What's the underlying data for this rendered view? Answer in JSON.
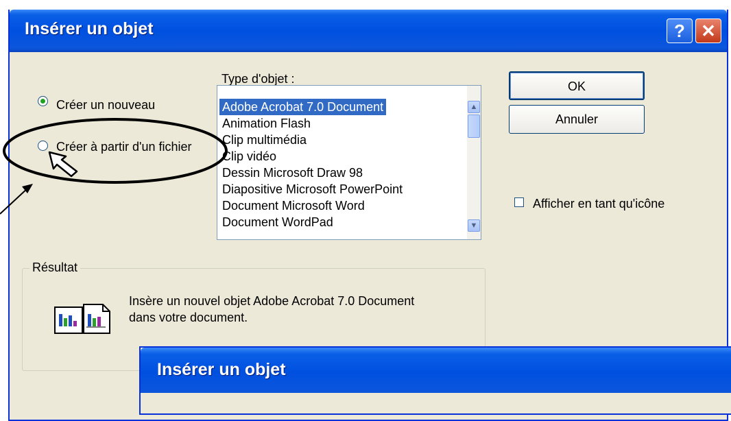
{
  "dialog": {
    "title": "Insérer un objet",
    "help_label": "?",
    "close_label": "✕"
  },
  "options": {
    "create_new": "Créer un nouveau",
    "create_from_file": "Créer à partir d'un fichier",
    "selected": "create_new"
  },
  "object_type": {
    "label": "Type d'objet :",
    "items": [
      "Adobe Acrobat 7.0 Document",
      "Animation Flash",
      "Clip multimédia",
      "Clip vidéo",
      "Dessin Microsoft Draw 98",
      "Diapositive Microsoft PowerPoint",
      "Document Microsoft Word",
      "Document WordPad"
    ],
    "selected_index": 0
  },
  "buttons": {
    "ok": "OK",
    "cancel": "Annuler"
  },
  "display_as_icon": {
    "label": "Afficher en tant qu'icône",
    "checked": false
  },
  "result": {
    "legend": "Résultat",
    "line1": "Insère un nouvel objet Adobe Acrobat 7.0 Document",
    "line2": "dans votre document."
  },
  "second_dialog": {
    "title": "Insérer un objet"
  },
  "colors": {
    "titlebar": "#0050e0",
    "face": "#ece9d8",
    "selection": "#316ac5"
  }
}
